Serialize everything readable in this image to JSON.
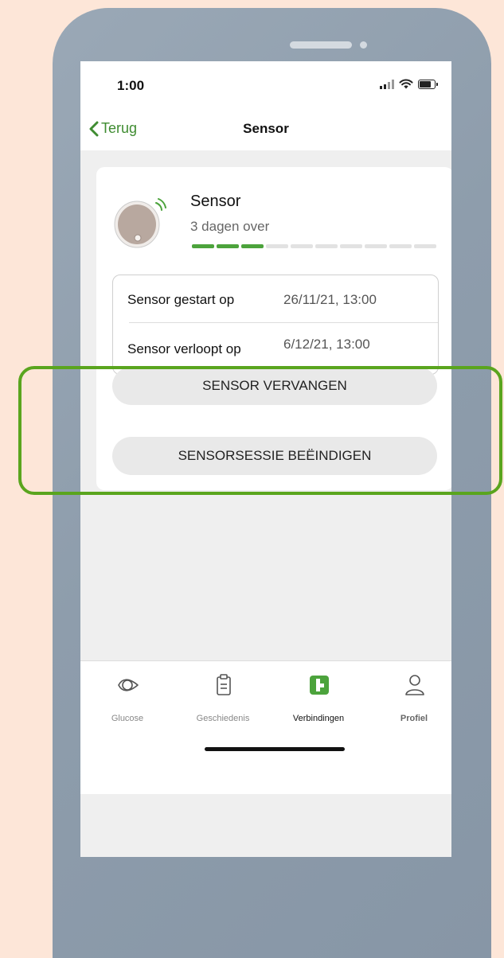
{
  "status_bar": {
    "time": "1:00"
  },
  "nav": {
    "back_label": "Terug",
    "title": "Sensor"
  },
  "sensor": {
    "name": "Sensor",
    "remaining": "3 dagen over",
    "progress": {
      "filled_segments": 3,
      "total_segments": 10
    },
    "started_label": "Sensor gestart op",
    "started_value": "26/11/21, 13:00",
    "expires_label": "Sensor verloopt op",
    "expires_value": "6/12/21, 13:00"
  },
  "actions": {
    "replace_label": "SENSOR VERVANGEN",
    "end_session_label": "SENSORSESSIE BEËINDIGEN"
  },
  "tabs": [
    {
      "label": "Glucose",
      "icon": "glucose-icon"
    },
    {
      "label": "Geschiedenis",
      "icon": "clipboard-icon"
    },
    {
      "label": "Verbindingen",
      "icon": "connections-icon"
    },
    {
      "label": "Profiel",
      "icon": "person-icon"
    }
  ],
  "colors": {
    "accent": "#3f8c31",
    "progress": "#4ca33c",
    "highlight": "#5aa51e",
    "background": "#fde6d8"
  }
}
